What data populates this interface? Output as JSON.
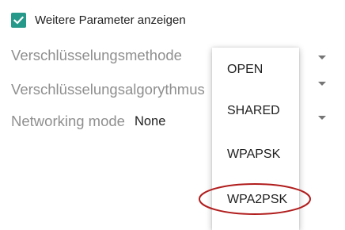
{
  "checkbox": {
    "label": "Weitere Parameter anzeigen",
    "checked": true,
    "color": "#26998a"
  },
  "fields": [
    {
      "label": "Verschlüsselungsmethode",
      "value": ""
    },
    {
      "label": "Verschlüsselungsalgorythmus",
      "value": ""
    },
    {
      "label": "Networking mode",
      "value": "None"
    }
  ],
  "dropdown_menu": {
    "options": [
      "OPEN",
      "SHARED",
      "WPAPSK",
      "WPA2PSK"
    ],
    "highlighted_option": "WPA2PSK",
    "highlight_color": "#b11d1d"
  },
  "icons": {
    "checkbox": "checkmark-icon",
    "dropdown": "dropdown-arrow-icon"
  }
}
